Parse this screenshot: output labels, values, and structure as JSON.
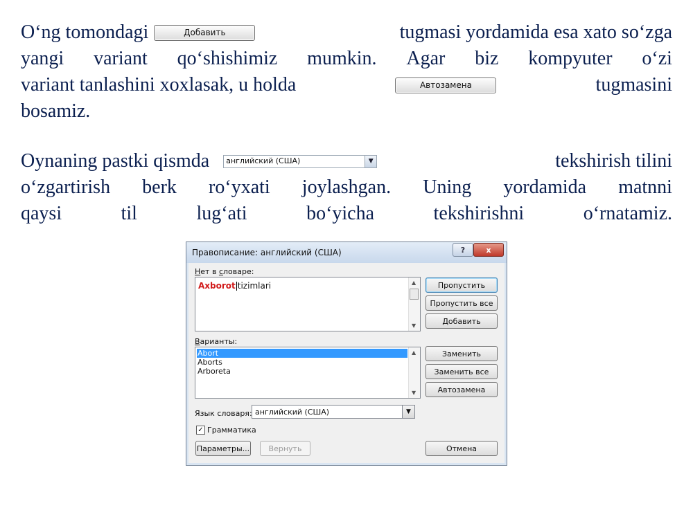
{
  "paragraph1": {
    "l1_a": "O‘ng tomondagi",
    "inline_button": "Добавить",
    "l1_b": "tugmasi yordamida esa xato so‘zga",
    "l2": [
      "yangi",
      "variant",
      "qo‘shishimiz",
      "mumkin.",
      "Agar",
      "biz",
      "kompyuter",
      "o‘zi"
    ],
    "l3_a": "variant tanlashini xoxlasak, u holda",
    "inline_button2": "Автозамена",
    "l3_b": "tugmasini",
    "l4": "bosamiz."
  },
  "paragraph2": {
    "l1_a": "Oynaning pastki qismda",
    "inline_combo": "английский (США)",
    "l1_b": "tekshirish tilini",
    "l2": [
      "o‘zgartirish",
      "berk",
      "ro‘yxati",
      "joylashgan.",
      "Uning",
      "yordamida",
      "matnni"
    ],
    "l3": "qaysi til lug‘ati bo‘yicha tekshirishni o‘rnatamiz."
  },
  "dialog": {
    "title": "Правописание: английский (США)",
    "help": "?",
    "close": "x",
    "not_in_dict_label": "Нет в словаре:",
    "error_word": "Axborot",
    "rest_text": "tizimlari",
    "suggestions_label": "Варианты:",
    "suggestions": [
      "Abort",
      "Aborts",
      "Arboreta"
    ],
    "language_label": "Язык словаря:",
    "language_value": "английский (США)",
    "grammar_label": "Грамматика",
    "grammar_checked": true,
    "buttons": {
      "skip": "Пропустить",
      "skip_all": "Пропустить все",
      "add": "Добавить",
      "replace": "Заменить",
      "replace_all": "Заменить все",
      "autocorrect": "Автозамена",
      "options": "Параметры...",
      "undo": "Вернуть",
      "cancel": "Отмена"
    }
  }
}
